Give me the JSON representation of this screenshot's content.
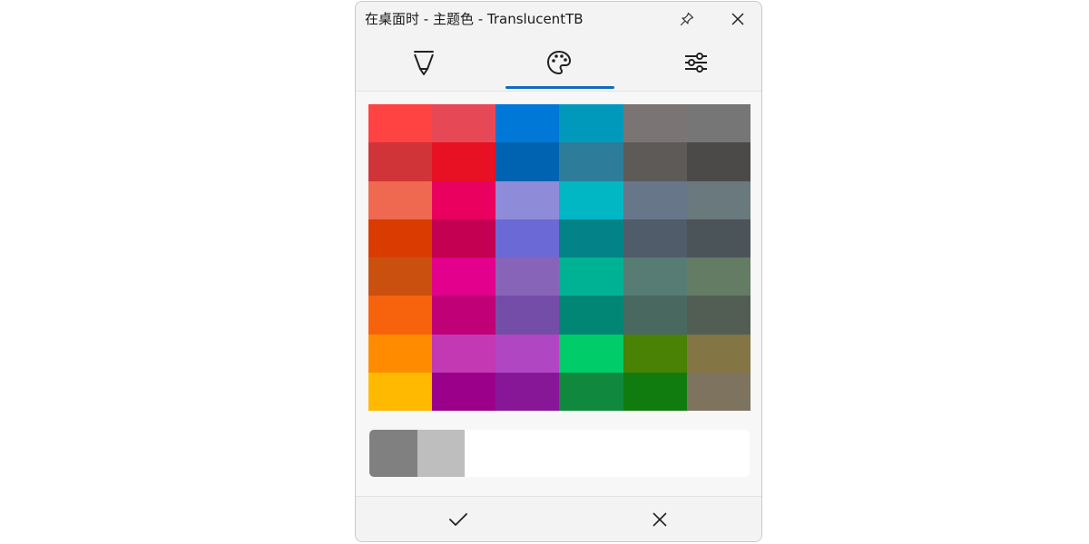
{
  "window": {
    "title": "在桌面时 - 主题色 - TranslucentTB"
  },
  "titlebar_buttons": {
    "pin_icon": "pin-icon",
    "close_icon": "close-icon"
  },
  "tabs": [
    {
      "icon": "color-picker-pen-icon",
      "selected": false
    },
    {
      "icon": "palette-icon",
      "selected": true
    },
    {
      "icon": "sliders-icon",
      "selected": false
    }
  ],
  "accent_color": "#0f6cbd",
  "swatches": [
    "#ff4343",
    "#e74856",
    "#0078d7",
    "#0099bc",
    "#7a7574",
    "#767676",
    "#d13438",
    "#e81123",
    "#0063b1",
    "#2d7d9a",
    "#5d5a58",
    "#4c4a48",
    "#ef6950",
    "#ea005e",
    "#8e8cd8",
    "#00b7c3",
    "#68768a",
    "#69797e",
    "#da3b01",
    "#c30052",
    "#6b69d6",
    "#038387",
    "#515c6b",
    "#4a5459",
    "#ca5010",
    "#e3008c",
    "#8764b8",
    "#00b294",
    "#567c73",
    "#647c64",
    "#f7630c",
    "#bf0077",
    "#744da9",
    "#018574",
    "#486860",
    "#525e54",
    "#ff8c00",
    "#c239b3",
    "#b146c2",
    "#00cc6a",
    "#498205",
    "#847545",
    "#ffb900",
    "#9a0089",
    "#881798",
    "#10893e",
    "#107c10",
    "#7e735f"
  ],
  "preview": {
    "old_color": "#808080",
    "new_color": "#bebebe"
  },
  "footer": {
    "ok_icon": "checkmark-icon",
    "cancel_icon": "close-icon"
  }
}
